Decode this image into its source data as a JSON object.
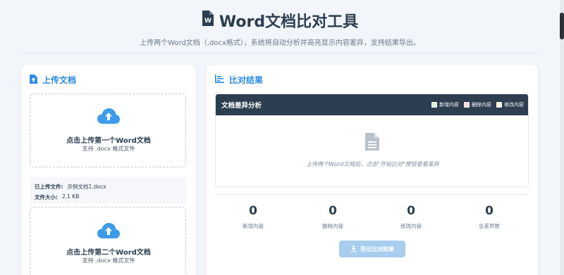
{
  "header": {
    "title": "Word文档比对工具",
    "subtitle": "上传两个Word文档（.docx格式），系统将自动分析并高亮显示内容差异，支持结果导出。"
  },
  "upload": {
    "title": "上传文档",
    "zone1": {
      "main": "点击上传第一个Word文档",
      "sub": "支持 .docx 格式文件"
    },
    "file_info": {
      "name_label": "已上传文件:",
      "name_value": "示例文档1.docx",
      "size_label": "文件大小:",
      "size_value": "2.1 KB"
    },
    "zone2": {
      "main": "点击上传第二个Word文档",
      "sub": "支持 .docx 格式文件"
    }
  },
  "results": {
    "title": "比对结果",
    "panel_title": "文档差异分析",
    "legend": [
      {
        "label": "新增内容",
        "color": "#d4f4d4"
      },
      {
        "label": "删除内容",
        "color": "#f8d7da"
      },
      {
        "label": "修改内容",
        "color": "#fff3cd"
      }
    ],
    "empty_text": "上传两个Word文档后，点击\"开始比对\"按钮查看差异",
    "stats": [
      {
        "value": "0",
        "label": "新增内容"
      },
      {
        "value": "0",
        "label": "删除内容"
      },
      {
        "value": "0",
        "label": "修改内容"
      },
      {
        "value": "0",
        "label": "总差异数"
      }
    ],
    "export_label": "导出比对结果"
  },
  "colors": {
    "accent": "#2a8be0",
    "dark": "#2c3e50",
    "export_button": "#a8cdee"
  }
}
